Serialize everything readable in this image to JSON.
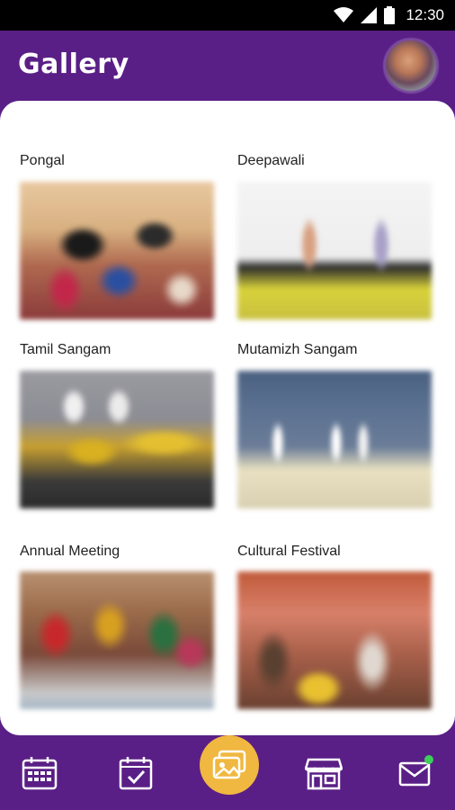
{
  "status_bar": {
    "time": "12:30"
  },
  "app_bar": {
    "title": "Gallery"
  },
  "gallery": {
    "items": [
      {
        "label": "Pongal"
      },
      {
        "label": "Deepawali"
      },
      {
        "label": "Tamil Sangam"
      },
      {
        "label": "Mutamizh Sangam"
      },
      {
        "label": "Annual Meeting"
      },
      {
        "label": "Cultural Festival"
      }
    ]
  },
  "bottom_nav": {
    "items": [
      {
        "icon": "calendar-icon"
      },
      {
        "icon": "checklist-icon"
      },
      {
        "icon": "gallery-icon",
        "active": true
      },
      {
        "icon": "store-icon"
      },
      {
        "icon": "mail-icon",
        "badge": true
      }
    ]
  },
  "colors": {
    "primary": "#5a1f86",
    "accent": "#f0b840",
    "badge": "#3ccf5a"
  }
}
